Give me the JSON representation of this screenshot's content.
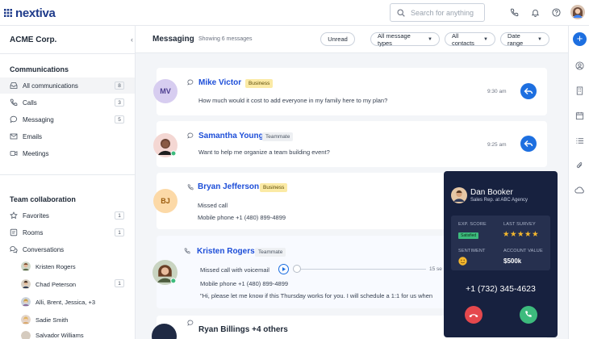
{
  "app": {
    "logo": "nextiva"
  },
  "search": {
    "placeholder": "Search for anything"
  },
  "account": {
    "name": "ACME Corp."
  },
  "communications": {
    "title": "Communications",
    "items": [
      {
        "label": "All communications",
        "count": "8"
      },
      {
        "label": "Calls",
        "count": "3"
      },
      {
        "label": "Messaging",
        "count": "5"
      },
      {
        "label": "Emails",
        "count": ""
      },
      {
        "label": "Meetings",
        "count": ""
      }
    ]
  },
  "team": {
    "title": "Team collaboration",
    "items": [
      {
        "label": "Favorites",
        "count": "1"
      },
      {
        "label": "Rooms",
        "count": "1"
      },
      {
        "label": "Conversations",
        "count": ""
      }
    ],
    "conversations": [
      {
        "label": "Kristen Rogers",
        "count": ""
      },
      {
        "label": "Chad Peterson",
        "count": "1"
      },
      {
        "label": "Alli, Brent, Jessica, +3",
        "count": ""
      },
      {
        "label": "Sadie Smith",
        "count": ""
      },
      {
        "label": "Salvador Williams",
        "count": ""
      }
    ]
  },
  "header": {
    "title": "Messaging",
    "subtitle": "Showing 6 messages",
    "unread": "Unread",
    "filters": [
      "All message types",
      "All contacts",
      "Date range"
    ]
  },
  "messages": [
    {
      "initials": "MV",
      "name": "Mike Victor",
      "tag": "Business",
      "body": "How much would it cost to add everyone in my family here to my plan?",
      "time": "9:30 am"
    },
    {
      "initials": "",
      "name": "Samantha Young",
      "tag": "Teammate",
      "body": "Want to help me organize a team building event?",
      "time": "9:25 am"
    },
    {
      "initials": "BJ",
      "name": "Bryan Jefferson",
      "tag": "Business",
      "line1": "Missed call",
      "line2": "Mobile phone +1 (480) 899-4899"
    },
    {
      "initials": "",
      "name": "Kristen Rogers",
      "tag": "Teammate",
      "line1": "Missed call with voicemail",
      "duration": "15 se",
      "line2": "Mobile phone +1 (480) 899-4899",
      "line3": "\"Hi, please let me know if this Thursday works for you. I will schedule a 1:1 for us when"
    },
    {
      "initials": "",
      "name": "Ryan Billings +4 others"
    }
  ],
  "call": {
    "name": "Dan Booker",
    "role": "Sales Rep. at ABC Agency",
    "exp_label": "EXP. SCORE",
    "exp_value": "Satisfied",
    "survey_label": "LAST SURVEY",
    "stars": "★★★★★",
    "sentiment_label": "SENTIMENT",
    "account_label": "ACCOUNT VALUE",
    "account_value": "$500k",
    "phone": "+1 (732) 345-4623"
  },
  "colors": {
    "brand": "#1e3a8a",
    "accent": "#1d6fe0",
    "decline": "#e5484d",
    "accept": "#3dbb7d",
    "popup": "#17213f"
  }
}
